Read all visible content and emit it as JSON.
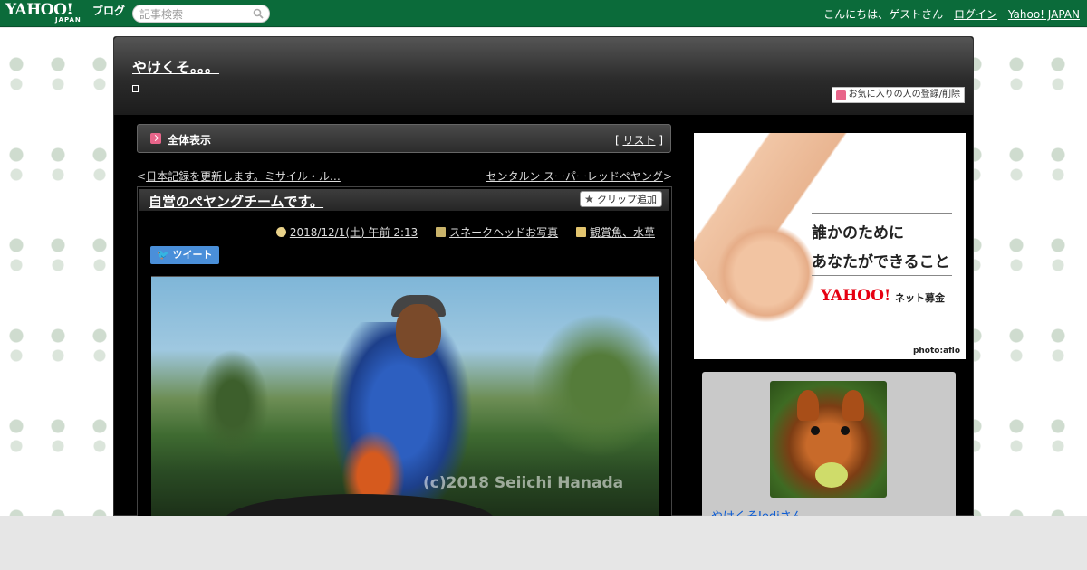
{
  "topbar": {
    "logo_text": "YAHOO!",
    "logo_sub": "JAPAN",
    "logo_blog": "ブログ",
    "search_placeholder": "記事検索",
    "greeting": "こんにちは、ゲストさん",
    "login_label": "ログイン",
    "yahoo_japan_label": "Yahoo! JAPAN"
  },
  "blog": {
    "title": "やけくそ。。。",
    "favorite_button": "お気に入りの人の登録/削除"
  },
  "nav": {
    "title": "全体表示",
    "list_label": "リスト",
    "bracket_open": "[",
    "bracket_close": "]"
  },
  "prevnext": {
    "prev_arrow": "<",
    "prev_label": "日本記録を更新します。ミサイル・ル…",
    "next_label": "センタルン スーパーレッドペヤング",
    "next_arrow": ">"
  },
  "article": {
    "title": "自営のペヤングチームです。",
    "clip_button": "クリップ追加",
    "date": "2018/12/1(土) 午前 2:13",
    "book_category": "スネークヘッドお写真",
    "folder_category": "観賞魚、水草",
    "tweet_button": "ツイート",
    "photo_watermark": "(c)2018 Seiichi Hanada"
  },
  "ad": {
    "line1": "誰かのために",
    "line2": "あなたができること",
    "logo": "YAHOO!",
    "logo_label": "ネット募金",
    "credit": "photo:aflo"
  },
  "profile": {
    "name": "やけくそJediさん"
  },
  "colors": {
    "topbar": "#0b6b3a",
    "link_blue": "#0b5bd3",
    "accent_pink": "#e8658a",
    "tweet_blue": "#4a8fd9"
  }
}
